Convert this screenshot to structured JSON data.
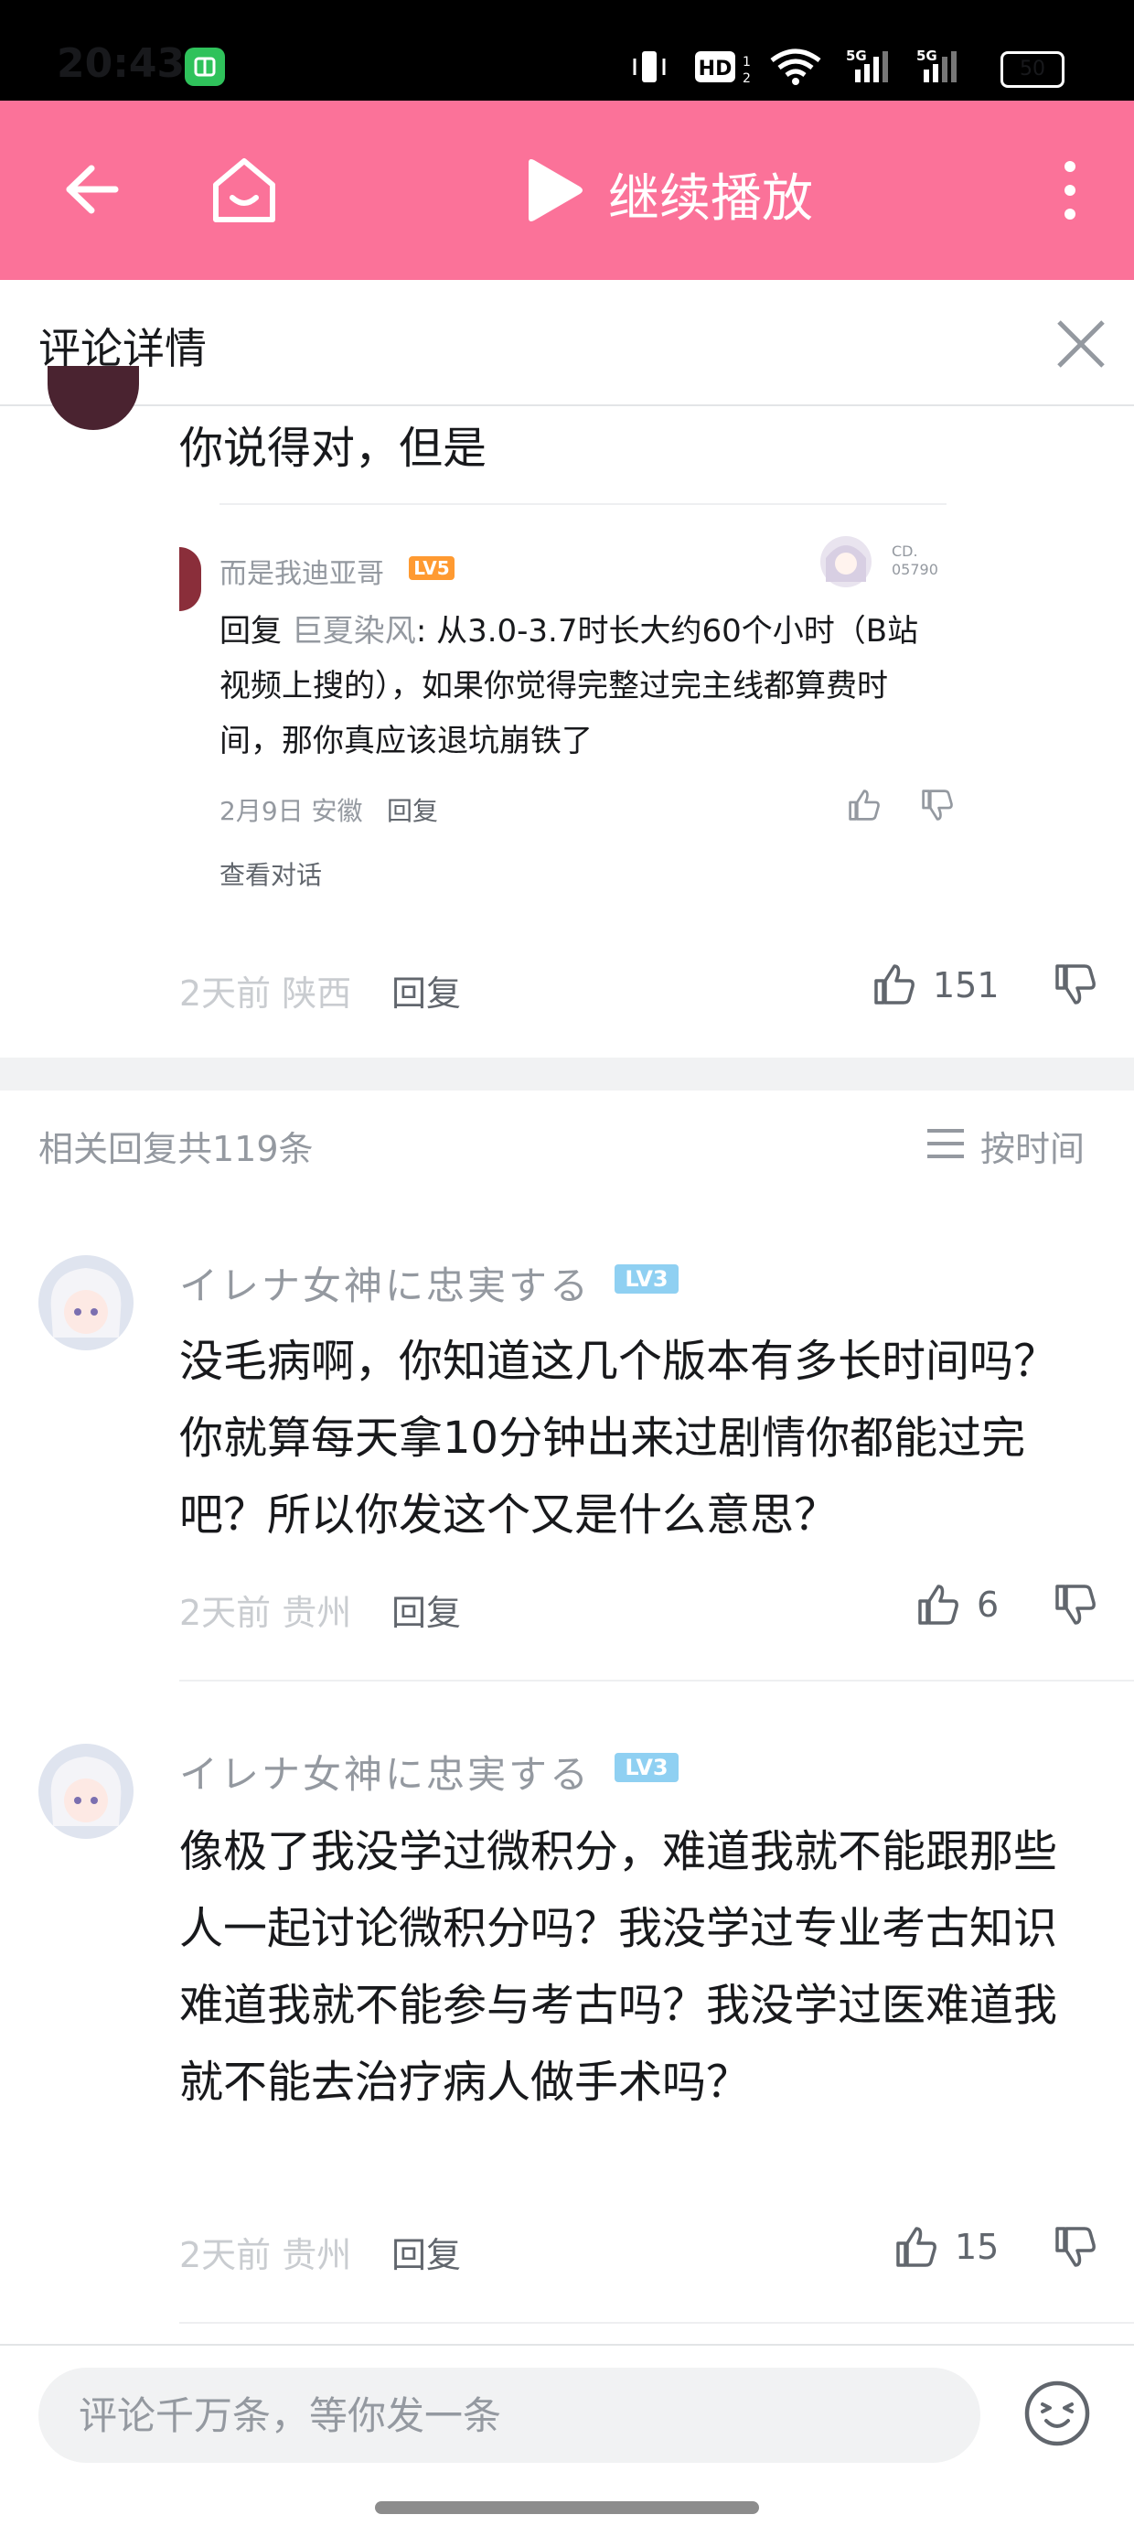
{
  "status_bar": {
    "time": "20:43",
    "battery": "50",
    "hd_label": "HD",
    "network_label": "5G"
  },
  "nav": {
    "title": "继续播放",
    "icons": [
      "back-arrow-icon",
      "home-icon",
      "play-icon",
      "more-vertical-icon"
    ]
  },
  "header": {
    "title": "评论详情"
  },
  "main_comment": {
    "text": "你说得对，但是",
    "quote": {
      "user": "而是我迪亚哥",
      "level": "LV5",
      "reply_prefix": "回复",
      "mention": "巨夏染风",
      "body": ": 从3.0-3.7时长大约60个小时（B站视频上搜的），如果你觉得完整过完主线都算费时间，那你真应该退坑崩铁了",
      "meta": "2月9日 安徽",
      "reply_label": "回复",
      "view_conversation": "查看对话"
    },
    "meta": "2天前 陕西",
    "reply_label": "回复",
    "like_count": "151"
  },
  "related": {
    "count_label": "相关回复共119条",
    "sort_label": "按时间"
  },
  "replies": [
    {
      "user": "イレナ女神に忠実する",
      "level": "LV3",
      "text": "没毛病啊，你知道这几个版本有多长时间吗？你就算每天拿10分钟出来过剧情你都能过完吧？所以你发这个又是什么意思？",
      "meta": "2天前 贵州",
      "reply_label": "回复",
      "like_count": "6"
    },
    {
      "user": "イレナ女神に忠実する",
      "level": "LV3",
      "text": "像极了我没学过微积分，难道我就不能跟那些人一起讨论微积分吗？我没学过专业考古知识难道我就不能参与考古吗？我没学过医难道我就不能去治疗病人做手术吗？",
      "meta": "2天前 贵州",
      "reply_label": "回复",
      "like_count": "15"
    }
  ],
  "bottom": {
    "input_placeholder": "评论千万条，等你发一条"
  },
  "colors": {
    "brand_pink": "#fb7299",
    "text_primary": "#18191c",
    "text_secondary": "#9499a0",
    "level_blue": "#8fd0f2",
    "level_orange": "#ff9a31"
  }
}
